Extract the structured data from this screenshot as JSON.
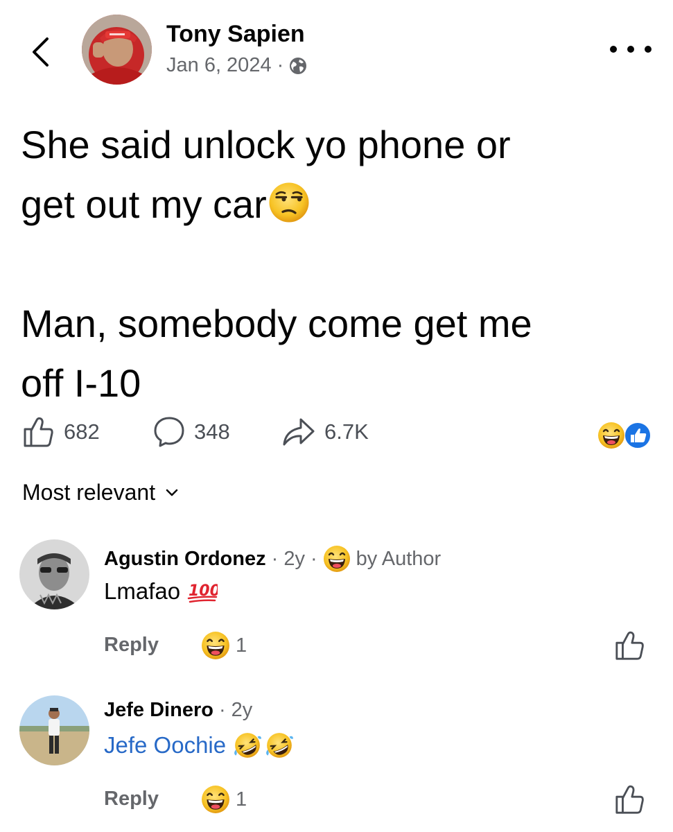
{
  "post": {
    "author": "Tony Sapien",
    "date": "Jan 6, 2024",
    "separator": "·",
    "line1": "She said unlock yo phone or",
    "line2": "get out my car",
    "line3": "Man, somebody come get me",
    "line4": "off I-10",
    "post_emoji": "unamused-face-icon"
  },
  "actions": {
    "likes": "682",
    "comments": "348",
    "shares": "6.7K"
  },
  "sort": {
    "label": "Most relevant"
  },
  "comments": [
    {
      "name": "Agustin Ordonez",
      "time": "· 2y ·",
      "badge": "by Author",
      "text": "Lmafao",
      "reply": "Reply",
      "reaction_count": "1"
    },
    {
      "name": "Jefe Dinero",
      "time": "· 2y",
      "text": "Jefe Oochie",
      "reply": "Reply",
      "reaction_count": "1"
    }
  ],
  "colors": {
    "text": "#050505",
    "secondary": "#65676b",
    "link": "#2769c7",
    "like_blue": "#1b74e4",
    "emoji_yellow": "#f7c325"
  }
}
